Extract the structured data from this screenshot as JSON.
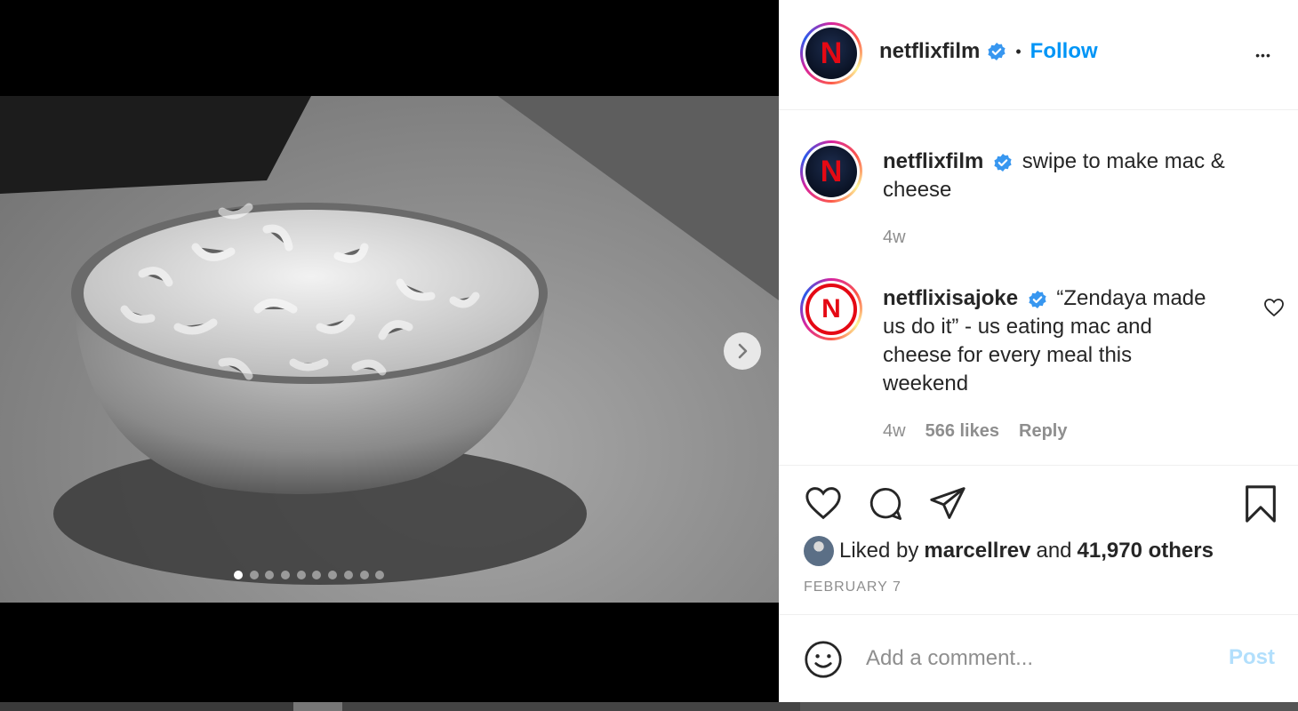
{
  "post": {
    "author": "netflixfilm",
    "follow_label": "Follow",
    "separator": "•",
    "more_label": "•••",
    "avatar_letter": "N"
  },
  "media": {
    "slide_count": 10,
    "active_slide": 1
  },
  "comments": [
    {
      "username": "netflixfilm",
      "verified": true,
      "text_line1": "swipe to make mac &",
      "text_line2": "cheese",
      "time": "4w"
    },
    {
      "username": "netflixisajoke",
      "verified": true,
      "text_line1": "“Zendaya made",
      "text_line2": "us do it” - us eating mac and",
      "text_line3": "cheese for every meal this",
      "text_line4": "weekend",
      "time": "4w",
      "likes": "566 likes",
      "reply_label": "Reply"
    }
  ],
  "likes": {
    "prefix": "Liked by",
    "user": "marcellrev",
    "and": "and",
    "others": "41,970 others"
  },
  "date": "FEBRUARY 7",
  "composer": {
    "placeholder": "Add a comment...",
    "post_label": "Post"
  },
  "colors": {
    "link": "#0095f6",
    "post_disabled": "#b2dffc",
    "verified": "#3897f0",
    "netflix_red": "#e50914"
  },
  "icons": [
    "verified-icon",
    "more-icon",
    "chevron-right-icon",
    "heart-icon",
    "comment-icon",
    "share-icon",
    "bookmark-icon",
    "emoji-icon"
  ]
}
